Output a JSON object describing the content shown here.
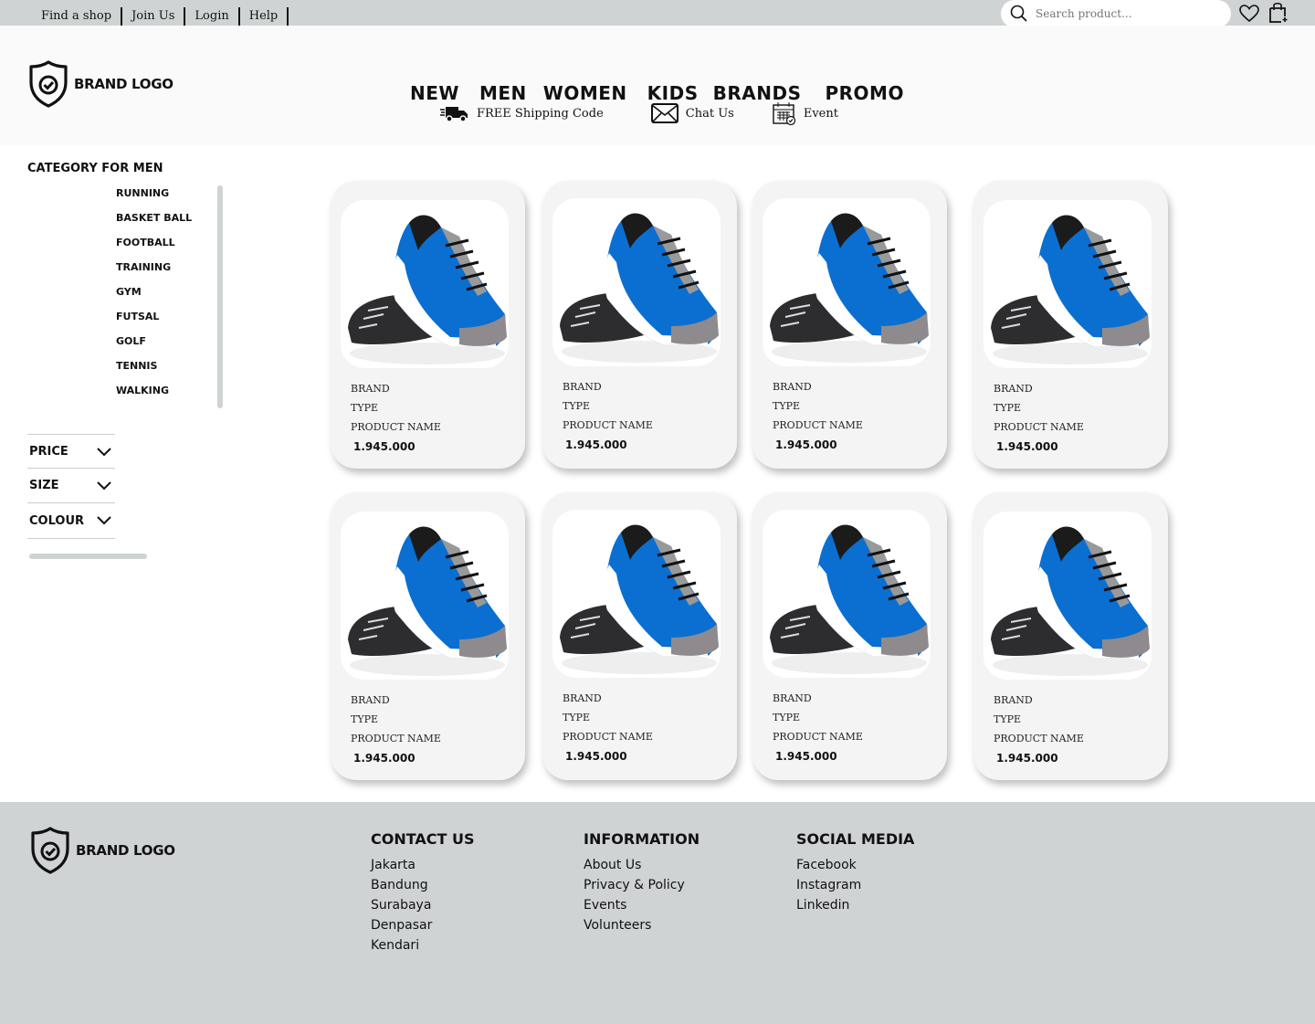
{
  "topbar": {
    "links": [
      "Find a shop",
      "Join Us",
      "Login",
      "Help"
    ],
    "search_placeholder": "Search product..."
  },
  "brand": {
    "logo_text": "BRAND LOGO"
  },
  "nav": {
    "items": [
      "NEW",
      "MEN",
      "WOMEN",
      "KIDS",
      "BRANDS",
      "PROMO"
    ]
  },
  "subnav": {
    "shipping": "FREE Shipping Code",
    "chat": "Chat Us",
    "event": "Event"
  },
  "sidebar": {
    "title": "CATEGORY FOR MEN",
    "categories": [
      "RUNNING",
      "BASKET BALL",
      "FOOTBALL",
      "TRAINING",
      "GYM",
      "FUTSAL",
      "GOLF",
      "TENNIS",
      "WALKING"
    ],
    "filters": [
      "PRICE",
      "SIZE",
      "COLOUR"
    ]
  },
  "products": [
    {
      "brand": "BRAND",
      "type": "TYPE",
      "name": "PRODUCT NAME",
      "price": "1.945.000"
    },
    {
      "brand": "BRAND",
      "type": "TYPE",
      "name": "PRODUCT NAME",
      "price": "1.945.000"
    },
    {
      "brand": "BRAND",
      "type": "TYPE",
      "name": "PRODUCT NAME",
      "price": "1.945.000"
    },
    {
      "brand": "BRAND",
      "type": "TYPE",
      "name": "PRODUCT NAME",
      "price": "1.945.000"
    },
    {
      "brand": "BRAND",
      "type": "TYPE",
      "name": "PRODUCT NAME",
      "price": "1.945.000"
    },
    {
      "brand": "BRAND",
      "type": "TYPE",
      "name": "PRODUCT NAME",
      "price": "1.945.000"
    },
    {
      "brand": "BRAND",
      "type": "TYPE",
      "name": "PRODUCT NAME",
      "price": "1.945.000"
    },
    {
      "brand": "BRAND",
      "type": "TYPE",
      "name": "PRODUCT NAME",
      "price": "1.945.000"
    }
  ],
  "footer": {
    "contact": {
      "title": "CONTACT US",
      "items": [
        "Jakarta",
        "Bandung",
        "Surabaya",
        "Denpasar",
        "Kendari"
      ]
    },
    "information": {
      "title": "INFORMATION",
      "items": [
        "About Us",
        "Privacy & Policy",
        "Events",
        "Volunteers"
      ]
    },
    "social": {
      "title": "SOCIAL MEDIA",
      "items": [
        "Facebook",
        "Instagram",
        "Linkedin"
      ]
    }
  },
  "colors": {
    "topbar": "#d0d3d4",
    "footer": "#d0d3d4",
    "shoe_blue": "#0a6fd1",
    "card": "#f4f4f4"
  }
}
